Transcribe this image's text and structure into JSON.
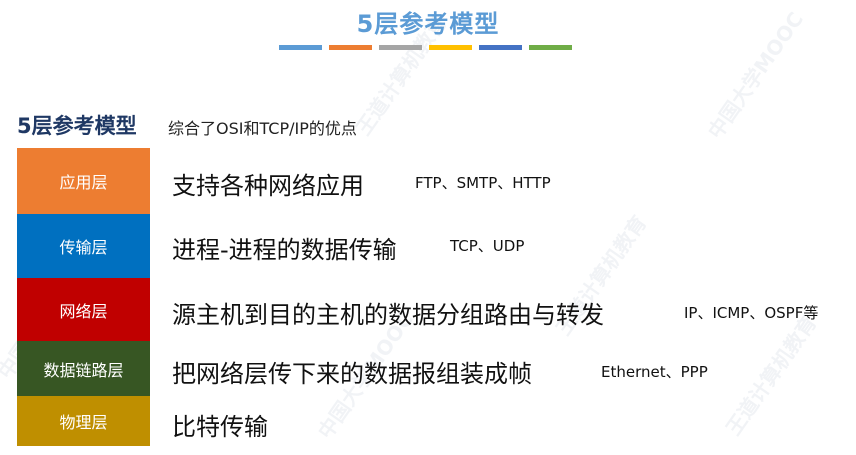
{
  "slide": {
    "title": "5层参考模型"
  },
  "title_bar_colors": [
    "#5b9bd5",
    "#ed7d31",
    "#a5a5a5",
    "#ffc000",
    "#4472c4",
    "#70ad47"
  ],
  "model": {
    "heading": "5层参考模型",
    "subheading": "综合了OSI和TCP/IP的优点"
  },
  "layers": [
    {
      "name": "应用层",
      "description": "支持各种网络应用",
      "protocols": "FTP、SMTP、HTTP",
      "color": "#ed7d31"
    },
    {
      "name": "传输层",
      "description": "进程-进程的数据传输",
      "protocols": "TCP、UDP",
      "color": "#0070c0"
    },
    {
      "name": "网络层",
      "description": "源主机到目的主机的数据分组路由与转发",
      "protocols": "IP、ICMP、OSPF等",
      "color": "#c00000"
    },
    {
      "name": "数据链路层",
      "description": "把网络层传下来的数据报组装成帧",
      "protocols": "Ethernet、PPP",
      "color": "#375623"
    },
    {
      "name": "物理层",
      "description": "比特传输",
      "protocols": "",
      "color": "#bf8f00"
    }
  ],
  "watermark": {
    "text_a": "中国大学MOOC",
    "text_b": "王道计算机教育"
  }
}
